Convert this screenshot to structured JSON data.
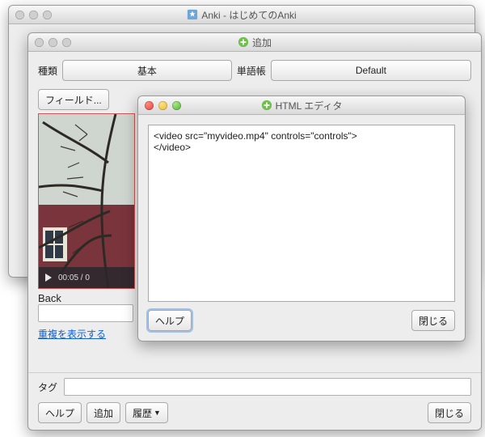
{
  "main_window": {
    "title": "Anki - はじめてのAnki"
  },
  "add_window": {
    "title": "追加",
    "type_label": "種類",
    "type_value": "基本",
    "deck_label": "単語帳",
    "deck_value": "Default",
    "fields_btn": "フィールド...",
    "back_label": "Back",
    "show_dup": "重複を表示する",
    "tag_label": "タグ",
    "help_btn": "ヘルプ",
    "add_btn": "追加",
    "history_btn": "履歴",
    "close_btn": "閉じる",
    "video_time": "00:05 / 0"
  },
  "html_window": {
    "title": "HTML エディタ",
    "code": "<video src=\"myvideo.mp4\" controls=\"controls\">\n</video>",
    "help_btn": "ヘルプ",
    "close_btn": "閉じる"
  }
}
